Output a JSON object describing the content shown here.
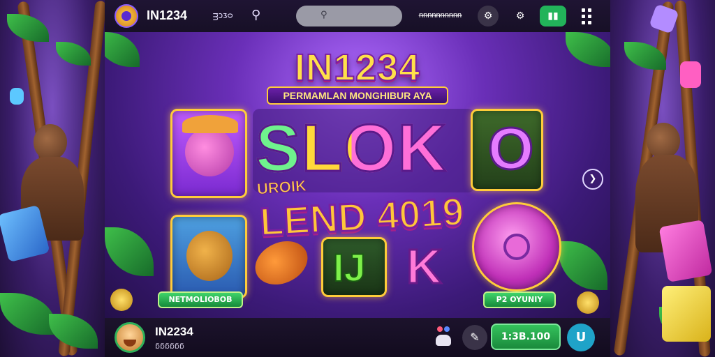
{
  "header": {
    "brand": "IN1234",
    "lang_label": "ᴟᴐᴣᴑ",
    "search_placeholder": "",
    "user_label": "ᵰᵰᵰᵰᵰᵰᵰᵰᵰᵰ",
    "icons": [
      "logo-icon",
      "search-icon",
      "shop-icon",
      "settings-icon",
      "wallet-icon",
      "grid-menu-icon"
    ]
  },
  "game": {
    "title": "IN1234",
    "subtitle": "PERMAMLAN MONGHIBUR AYA",
    "reel_letters": [
      "SLOK",
      "O",
      "IJ",
      "K"
    ],
    "banner": "LEND 4019",
    "banner_top": "UROIK",
    "left_label": "NETMOLIOBOB",
    "right_label": "P2 OYUNIY"
  },
  "footer": {
    "player_name": "IN2234",
    "player_sub": "ᵷᵷᵷᵷᵷᵷ",
    "balance": "1:3B.100",
    "u_button": "U"
  },
  "colors": {
    "accent_gold": "#ffcc3a",
    "purple_bg": "#6a2fb8",
    "green": "#22b35a"
  }
}
